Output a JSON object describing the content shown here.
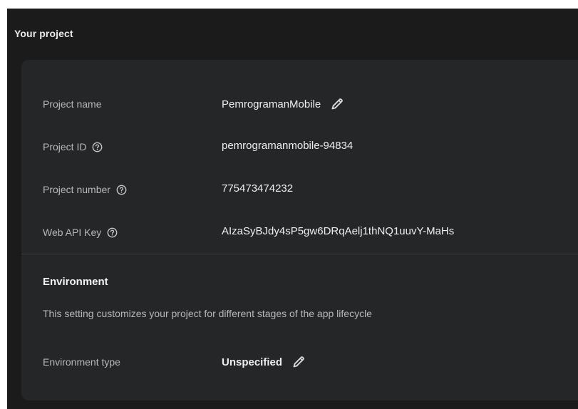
{
  "section": {
    "title": "Your project"
  },
  "details": [
    {
      "label": "Project name",
      "value": "PemrogramanMobile",
      "help": false,
      "editable": true
    },
    {
      "label": "Project ID",
      "value": "pemrogramanmobile-94834",
      "help": true,
      "editable": false
    },
    {
      "label": "Project number",
      "value": "775473474232",
      "help": true,
      "editable": false
    },
    {
      "label": "Web API Key",
      "value": "AIzaSyBJdy4sP5gw6DRqAelj1thNQ1uuvY-MaHs",
      "help": true,
      "editable": false
    }
  ],
  "environment": {
    "title": "Environment",
    "description": "This setting customizes your project for different stages of the app lifecycle",
    "type_label": "Environment type",
    "type_value": "Unspecified"
  },
  "icons": {
    "help": "help-circle-icon",
    "edit": "pencil-edit-icon"
  },
  "colors": {
    "page_background": "#1b1b1b",
    "card_background": "#252627",
    "label_text": "#b5b8bc",
    "value_text": "#eceff1"
  }
}
